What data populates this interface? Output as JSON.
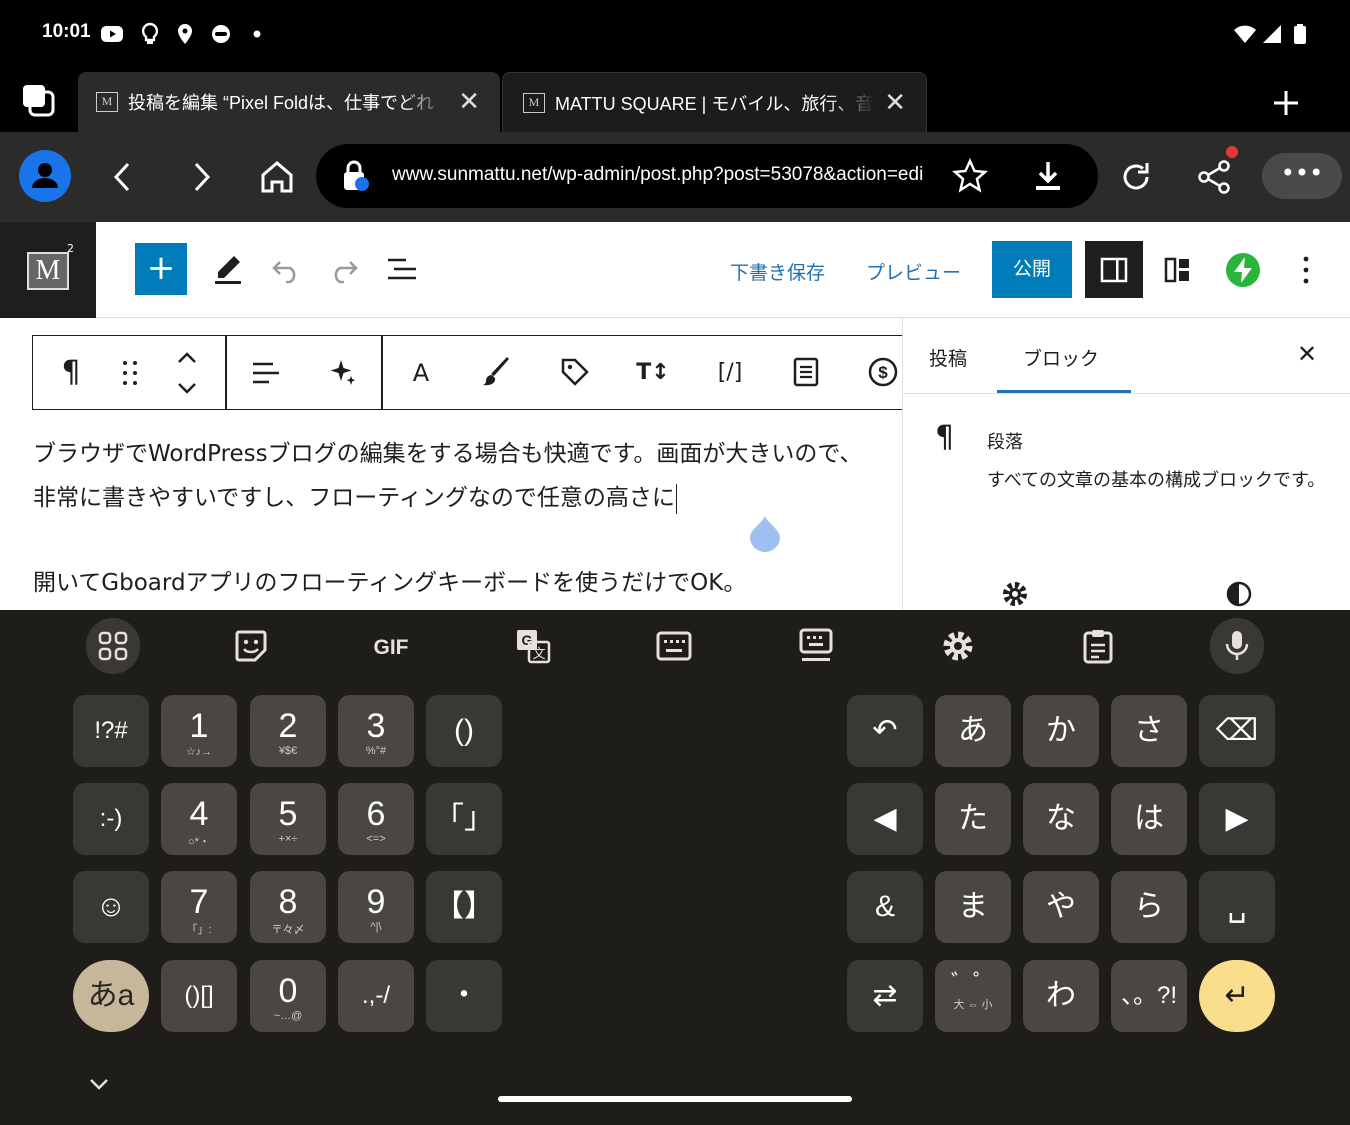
{
  "status_bar": {
    "time": "10:01"
  },
  "tabs": [
    {
      "title": "投稿を編集 “Pixel Foldは、仕事でどれ",
      "favicon": "M"
    },
    {
      "title": "MATTU SQUARE | モバイル、旅行、音",
      "favicon": "M"
    }
  ],
  "address_bar": {
    "url": "www.sunmattu.net/wp-admin/post.php?post=53078&action=edi",
    "more": "•••"
  },
  "wp_header": {
    "logo": "M",
    "save_draft": "下書き保存",
    "preview": "プレビュー",
    "publish": "公開",
    "add": "+"
  },
  "block_toolbar": {
    "pilcrow": "¶",
    "text_color": "A",
    "font_size": "T↕",
    "shortcode": "[/]"
  },
  "editor": {
    "paragraphs": [
      "ブラウザでWordPressブログの編集をする場合も快適です。画面が大きいので、非常に書きやすいですし、フローティングなので任意の高さに",
      "開いてGboardアプリのフローティングキーボードを使うだけでOK。"
    ]
  },
  "sidebar": {
    "tab_post": "投稿",
    "tab_block": "ブロック",
    "block_name": "段落",
    "block_desc": "すべての文章の基本の構成ブロックです。",
    "pilcrow": "¶"
  },
  "keyboard": {
    "toolbar": {
      "gif": "GIF"
    },
    "left": [
      [
        {
          "main": "!?#"
        },
        {
          "main": "1",
          "sub": "☆♪→"
        },
        {
          "main": "2",
          "sub": "¥$€"
        },
        {
          "main": "3",
          "sub": "%°#"
        },
        {
          "main": "()"
        }
      ],
      [
        {
          "main": ":-)"
        },
        {
          "main": "4",
          "sub": "○*・"
        },
        {
          "main": "5",
          "sub": "+×÷"
        },
        {
          "main": "6",
          "sub": "<=>"
        },
        {
          "main": "「」"
        }
      ],
      [
        {
          "main": "☺"
        },
        {
          "main": "7",
          "sub": "「」:"
        },
        {
          "main": "8",
          "sub": "〒々〆"
        },
        {
          "main": "9",
          "sub": "^|\\"
        },
        {
          "main": "【】"
        }
      ],
      [
        {
          "main": "あa"
        },
        {
          "main": "()[]"
        },
        {
          "main": "0",
          "sub": "~…@"
        },
        {
          "main": ".,-/"
        },
        {
          "main": "・"
        }
      ]
    ],
    "right": [
      [
        {
          "main": "↶"
        },
        {
          "main": "あ"
        },
        {
          "main": "か"
        },
        {
          "main": "さ"
        },
        {
          "main": "⌫"
        }
      ],
      [
        {
          "main": "◀"
        },
        {
          "main": "た"
        },
        {
          "main": "な"
        },
        {
          "main": "は"
        },
        {
          "main": "▶"
        }
      ],
      [
        {
          "main": "&"
        },
        {
          "main": "ま"
        },
        {
          "main": "や"
        },
        {
          "main": "ら"
        },
        {
          "main": "␣"
        }
      ],
      [
        {
          "main": "⇄"
        },
        {
          "main": "゛゜",
          "sub": "大 ⇔ 小"
        },
        {
          "main": "わ"
        },
        {
          "main": "、。?!"
        },
        {
          "main": "↵"
        }
      ]
    ]
  },
  "colors": {
    "wp_blue": "#007cba",
    "link_blue": "#2271b1",
    "accent_green": "#27b53a",
    "enter_key": "#f7dd8c"
  }
}
